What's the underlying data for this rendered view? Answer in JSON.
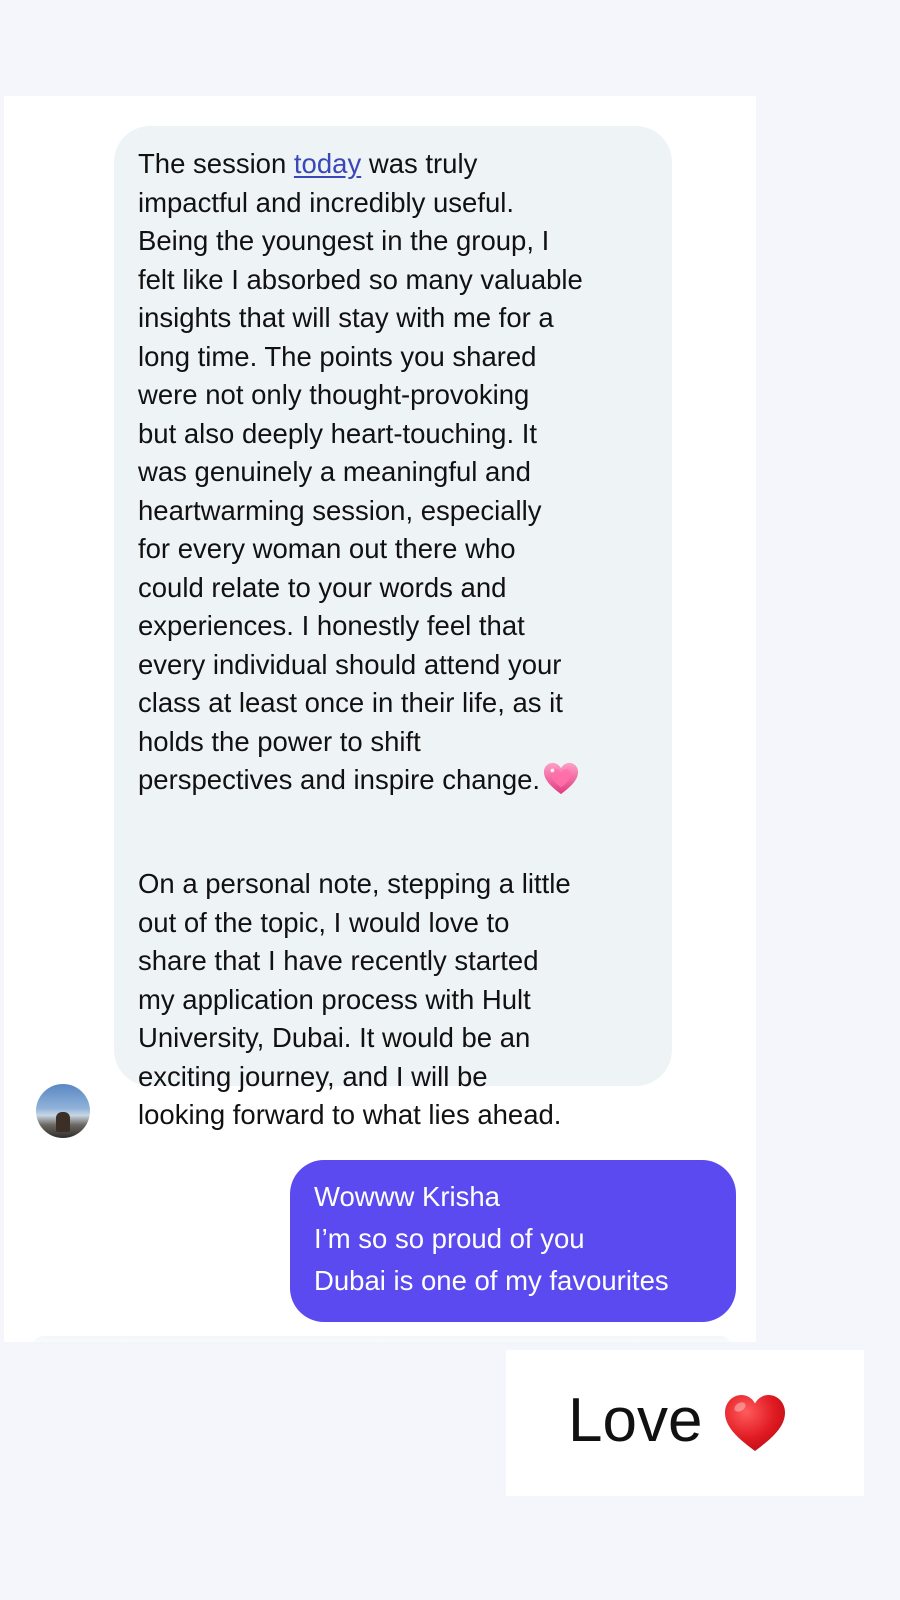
{
  "conversation": {
    "incoming_message": {
      "paragraph_1": {
        "text_before_link": "The session ",
        "link_text": "today",
        "text_after_link": " was truly\nimpactful and incredibly useful.\nBeing the youngest in the group, I\nfelt like I absorbed so many valuable\ninsights that will stay with me for a\nlong time. The points you shared\nwere not only thought-provoking\nbut also deeply heart-touching. It\nwas genuinely a meaningful and\nheartwarming session, especially\nfor every woman out there who\ncould relate to your words and\nexperiences. I honestly feel that\nevery individual should attend your\nclass at least once in their life, as it\nholds the power to shift\nperspectives and inspire change.",
        "trailing_emoji": "pink-sparkling-heart-icon"
      },
      "paragraph_2": "On a personal note, stepping a little\nout of the topic, I would love to\nshare that I have recently started\nmy application process with Hult\nUniversity, Dubai. It would be an\nexciting journey, and I will be\nlooking forward to what lies ahead."
    },
    "outgoing_message": {
      "lines": [
        "Wowww Krisha",
        "I’m so so proud of you",
        "Dubai is one of my favourites"
      ]
    }
  },
  "overlay_caption": {
    "text": "Love",
    "emoji": "red-heart-icon"
  },
  "colors": {
    "page_background": "#f4f6fb",
    "incoming_bubble": "#eef4f6",
    "outgoing_bubble": "#5a4af0",
    "link": "#3a47b8"
  }
}
